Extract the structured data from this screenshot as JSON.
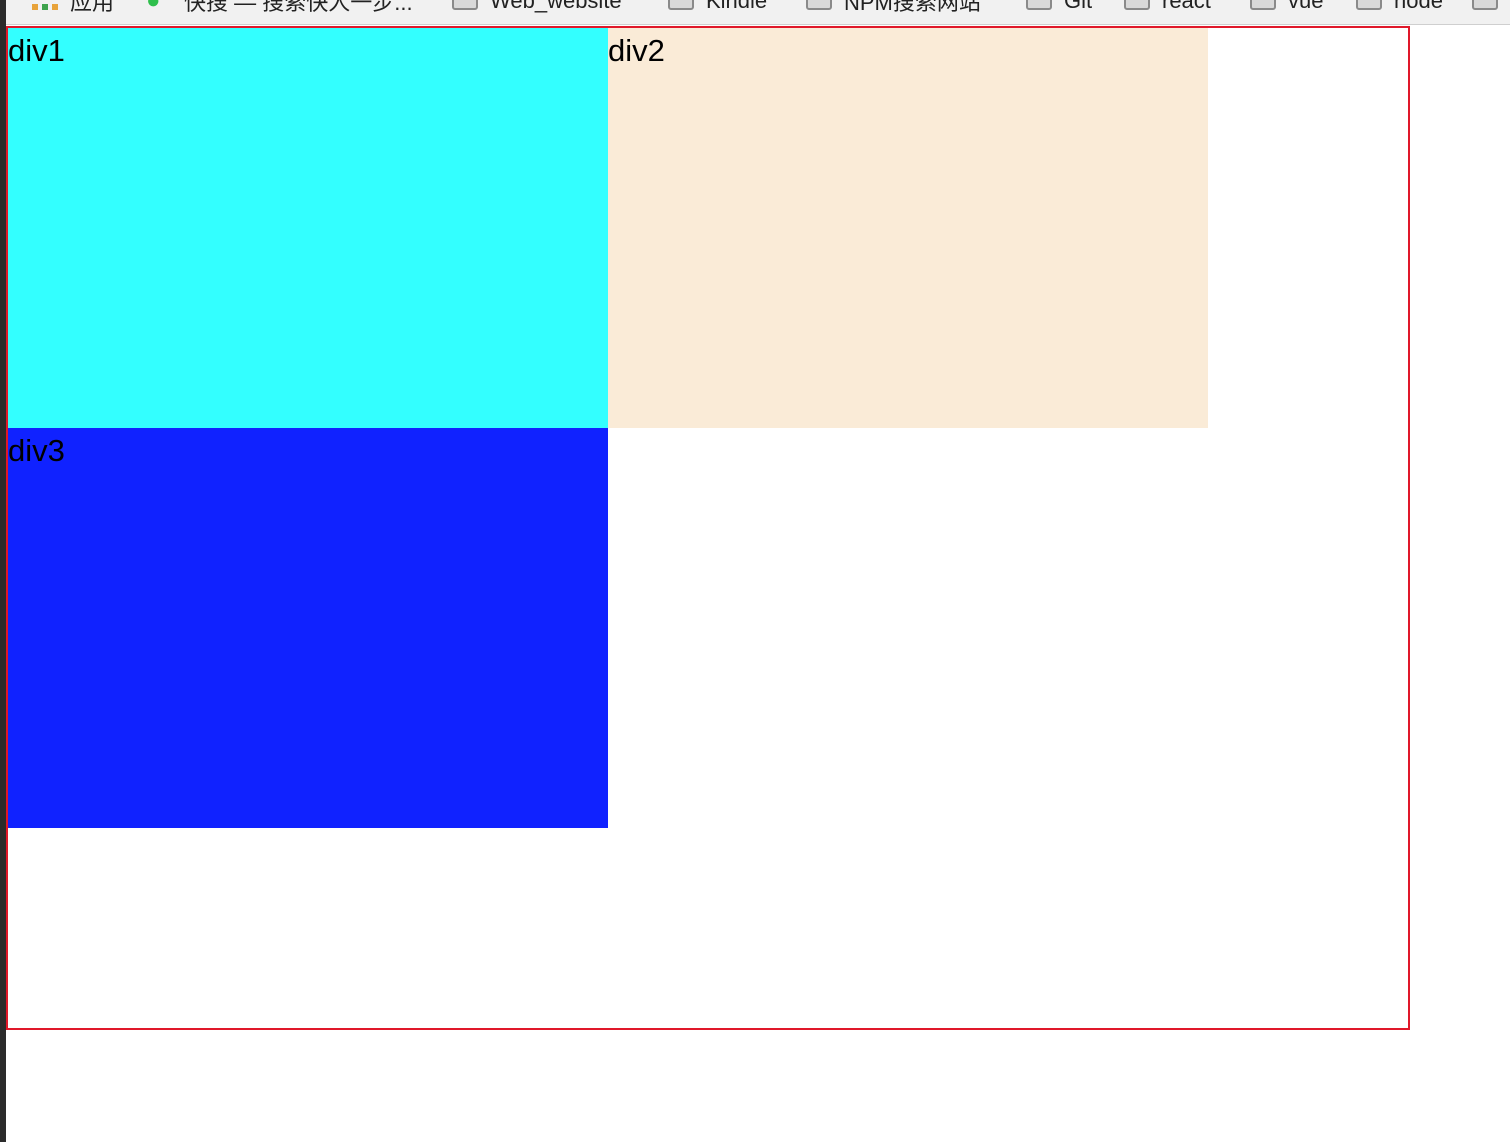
{
  "bookmarks": [
    {
      "label": "应用",
      "icon": "apps-grid-icon"
    },
    {
      "label": "快搜 — 搜索快人一步...",
      "icon": "qihoo-search-icon"
    },
    {
      "label": "Web_website",
      "icon": "folder-icon"
    },
    {
      "label": "Kindle",
      "icon": "folder-icon"
    },
    {
      "label": "NPM搜索网站",
      "icon": "folder-icon"
    },
    {
      "label": "Git",
      "icon": "folder-icon"
    },
    {
      "label": "react",
      "icon": "folder-icon"
    },
    {
      "label": "vue",
      "icon": "folder-icon"
    },
    {
      "label": "node",
      "icon": "folder-icon"
    }
  ],
  "container": {
    "border_color": "#e0182a"
  },
  "boxes": [
    {
      "label": "div1",
      "color": "#33ffff"
    },
    {
      "label": "div2",
      "color": "#faebd7"
    },
    {
      "label": "div3",
      "color": "#1022ff"
    }
  ]
}
